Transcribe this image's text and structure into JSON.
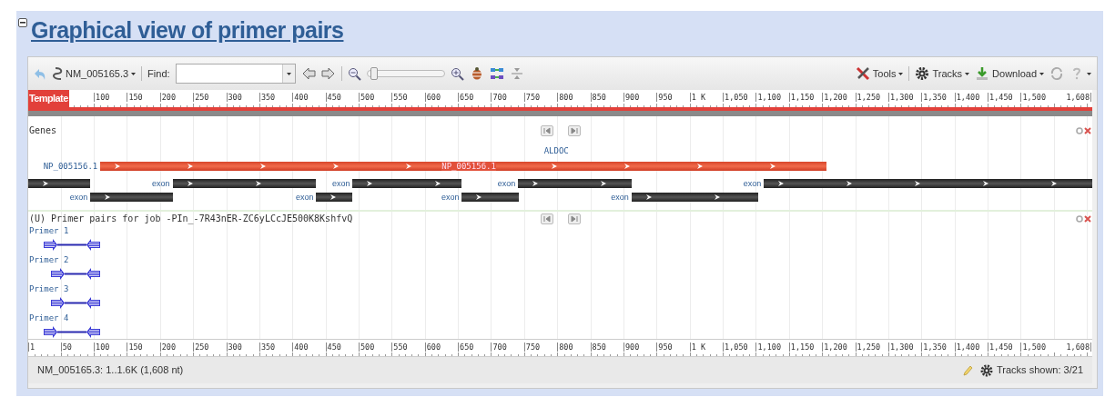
{
  "section": {
    "title": "Graphical view of primer pairs",
    "expanded": true
  },
  "toolbar": {
    "sequence": "NM_005165.3",
    "find_label": "Find:",
    "zoom": {
      "level": 0.04
    },
    "menus": [
      "Tools",
      "Tracks",
      "Download"
    ]
  },
  "ruler_top": {
    "label": "Template",
    "ticks": [
      "100",
      "150",
      "200",
      "250",
      "300",
      "350",
      "400",
      "450",
      "500",
      "550",
      "600",
      "650",
      "700",
      "750",
      "800",
      "850",
      "900",
      "950",
      "1 K",
      "1,050",
      "1,100",
      "1,150",
      "1,200",
      "1,250",
      "1,300",
      "1,350",
      "1,400",
      "1,450",
      "1,500",
      "1,608"
    ]
  },
  "tracks": [
    {
      "kind": "genes",
      "title": "Genes",
      "gene": "ALDOC",
      "protein": {
        "label": "NP_005156.1",
        "inner_label": "NP_005156.1"
      },
      "exon_rows": [
        [
          {},
          {
            "label": "exon"
          },
          {
            "label": "exon"
          },
          {
            "label": "exon"
          },
          {
            "label": "exon"
          }
        ],
        [
          {
            "label": "exon"
          },
          {
            "label": "exon"
          },
          {
            "label": "exon"
          },
          {
            "label": "exon"
          }
        ]
      ]
    },
    {
      "kind": "primers",
      "title": "(U) Primer pairs for job -PIn_-7R43nER-ZC6yLCcJE500K8KshfvQ",
      "primers": [
        {
          "label": "Primer 1"
        },
        {
          "label": "Primer 2"
        },
        {
          "label": "Primer 3"
        },
        {
          "label": "Primer 4"
        }
      ]
    }
  ],
  "ruler_bottom": {
    "ticks": [
      "1",
      "50",
      "100",
      "150",
      "200",
      "250",
      "300",
      "350",
      "400",
      "450",
      "500",
      "550",
      "600",
      "650",
      "700",
      "750",
      "800",
      "850",
      "900",
      "950",
      "1 K",
      "1,050",
      "1,100",
      "1,150",
      "1,200",
      "1,250",
      "1,300",
      "1,350",
      "1,400",
      "1,450",
      "1,500",
      "1,608"
    ]
  },
  "status_bar": {
    "range": "NM_005165.3: 1..1.6K (1,608 nt)",
    "tracks_shown": "Tracks shown: 3/21"
  }
}
